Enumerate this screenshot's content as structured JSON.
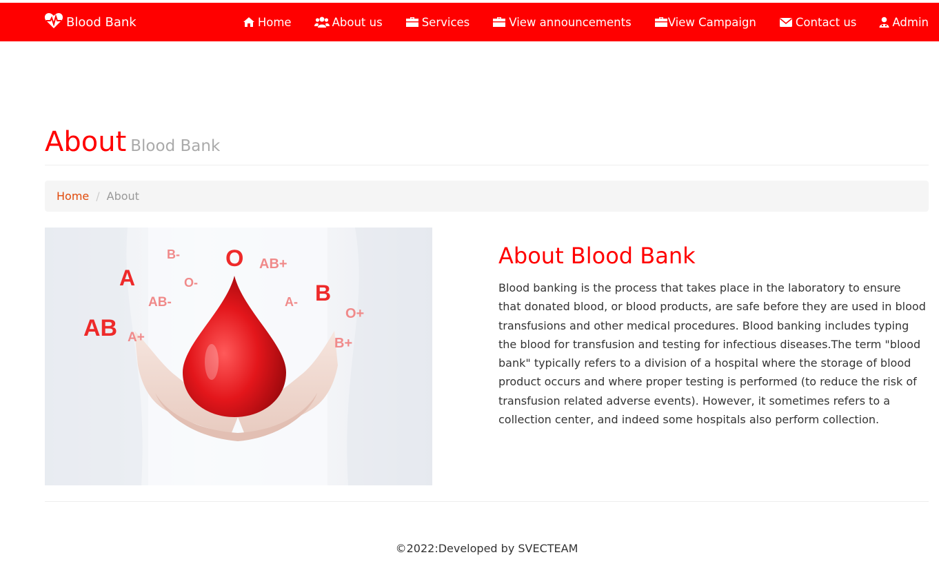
{
  "brand": {
    "name": "Blood Bank",
    "icon": "heartbeat-icon"
  },
  "nav": {
    "items": [
      {
        "label": "Home",
        "icon": "home-icon"
      },
      {
        "label": "About us",
        "icon": "users-icon"
      },
      {
        "label": "Services",
        "icon": "briefcase-icon"
      },
      {
        "label": "View announcements",
        "icon": "briefcase-icon"
      },
      {
        "label": "View Campaign",
        "icon": "briefcase-icon"
      },
      {
        "label": "Contact us",
        "icon": "envelope-icon"
      },
      {
        "label": "Admin",
        "icon": "user-md-icon"
      }
    ]
  },
  "header": {
    "title": "About",
    "subtitle": "Blood Bank"
  },
  "breadcrumb": {
    "home": "Home",
    "separator": "/",
    "current": "About"
  },
  "image": {
    "labels": [
      "B-",
      "O",
      "AB+",
      "A",
      "O-",
      "B",
      "AB-",
      "A-",
      "O+",
      "AB",
      "A+",
      "B+"
    ]
  },
  "about": {
    "heading": "About Blood Bank",
    "body": "Blood banking is the process that takes place in the laboratory to ensure that donated blood, or blood products, are safe before they are used in blood transfusions and other medical procedures. Blood banking includes typing the blood for transfusion and testing for infectious diseases.The term \"blood bank\" typically refers to a division of a hospital where the storage of blood product occurs and where proper testing is performed (to reduce the risk of transfusion related adverse events). However, it sometimes refers to a collection center, and indeed some hospitals also perform collection."
  },
  "footer": {
    "text": "©2022:Developed by SVECTEAM"
  },
  "colors": {
    "primary": "#ff0000",
    "link": "#e14a0b",
    "muted": "#aaaaaa",
    "breadcrumb_bg": "#f5f5f5"
  }
}
